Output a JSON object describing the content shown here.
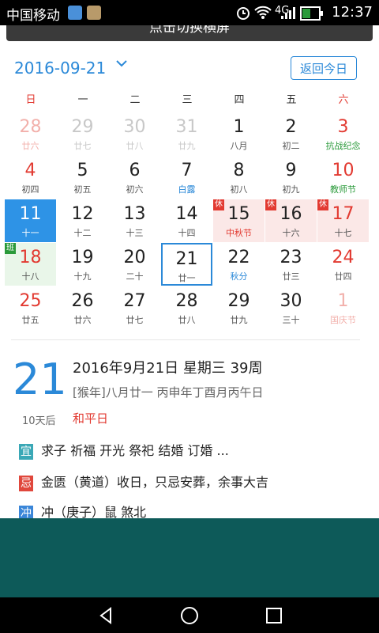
{
  "status_bar": {
    "carrier": "中国移动",
    "network": "4G",
    "battery": "5",
    "time": "12:37"
  },
  "banner": {
    "text": "点击切换横屏"
  },
  "header": {
    "current_date": "2016-09-21",
    "dropdown_icon": "chevron-down-icon",
    "today_button": "返回今日"
  },
  "weekdays": [
    "日",
    "一",
    "二",
    "三",
    "四",
    "五",
    "六"
  ],
  "calendar": [
    [
      {
        "n": "28",
        "l": "廿六",
        "type": "other",
        "red": true
      },
      {
        "n": "29",
        "l": "廿七",
        "type": "other"
      },
      {
        "n": "30",
        "l": "廿八",
        "type": "other"
      },
      {
        "n": "31",
        "l": "廿九",
        "type": "other"
      },
      {
        "n": "1",
        "l": "八月"
      },
      {
        "n": "2",
        "l": "初二"
      },
      {
        "n": "3",
        "l": "抗战纪念",
        "red": true,
        "lc": "green"
      }
    ],
    [
      {
        "n": "4",
        "l": "初四",
        "red": true
      },
      {
        "n": "5",
        "l": "初五"
      },
      {
        "n": "6",
        "l": "初六"
      },
      {
        "n": "7",
        "l": "白露",
        "lc": "blue"
      },
      {
        "n": "8",
        "l": "初八"
      },
      {
        "n": "9",
        "l": "初九"
      },
      {
        "n": "10",
        "l": "教师节",
        "red": true,
        "lc": "green"
      }
    ],
    [
      {
        "n": "11",
        "l": "十一",
        "type": "sel"
      },
      {
        "n": "12",
        "l": "十二"
      },
      {
        "n": "13",
        "l": "十三"
      },
      {
        "n": "14",
        "l": "十四"
      },
      {
        "n": "15",
        "l": "中秋节",
        "type": "holiday",
        "lc": "red",
        "badge": "休"
      },
      {
        "n": "16",
        "l": "十六",
        "type": "holiday",
        "badge": "休"
      },
      {
        "n": "17",
        "l": "十七",
        "type": "holiday",
        "red": true,
        "badge": "休"
      }
    ],
    [
      {
        "n": "18",
        "l": "十八",
        "type": "workday",
        "red": true,
        "badge": "班"
      },
      {
        "n": "19",
        "l": "十九"
      },
      {
        "n": "20",
        "l": "二十"
      },
      {
        "n": "21",
        "l": "廿一",
        "type": "today"
      },
      {
        "n": "22",
        "l": "秋分",
        "lc": "blue"
      },
      {
        "n": "23",
        "l": "廿三"
      },
      {
        "n": "24",
        "l": "廿四",
        "red": true
      }
    ],
    [
      {
        "n": "25",
        "l": "廿五",
        "red": true
      },
      {
        "n": "26",
        "l": "廿六"
      },
      {
        "n": "27",
        "l": "廿七"
      },
      {
        "n": "28",
        "l": "廿八"
      },
      {
        "n": "29",
        "l": "廿九"
      },
      {
        "n": "30",
        "l": "三十"
      },
      {
        "n": "1",
        "l": "国庆节",
        "type": "other",
        "red": true
      }
    ]
  ],
  "detail": {
    "day": "21",
    "days_after": "10天后",
    "date_line": "2016年9月21日 星期三 39周",
    "lunar_line": "[猴年]八月廿一 丙申年丁酉月丙午日",
    "festival": "和平日",
    "yi_tag": "宜",
    "yi_text": "求子  祈福  开光  祭祀  结婚  订婚  ...",
    "ji_tag": "忌",
    "ji_text": "金匮（黄道）收日，只忌安葬，余事大吉",
    "chong_tag": "冲",
    "chong_text": "冲（庚子）鼠  煞北"
  },
  "colors": {
    "accent": "#2b89d8",
    "red": "#e23a31",
    "green": "#2a9a3a",
    "teal": "#0d5a59",
    "yi_tag": "#3aa8b6",
    "ji_tag": "#e0473c",
    "chong_tag": "#3a86d8"
  },
  "nav_icons": [
    "back-icon",
    "home-icon",
    "recents-icon"
  ]
}
